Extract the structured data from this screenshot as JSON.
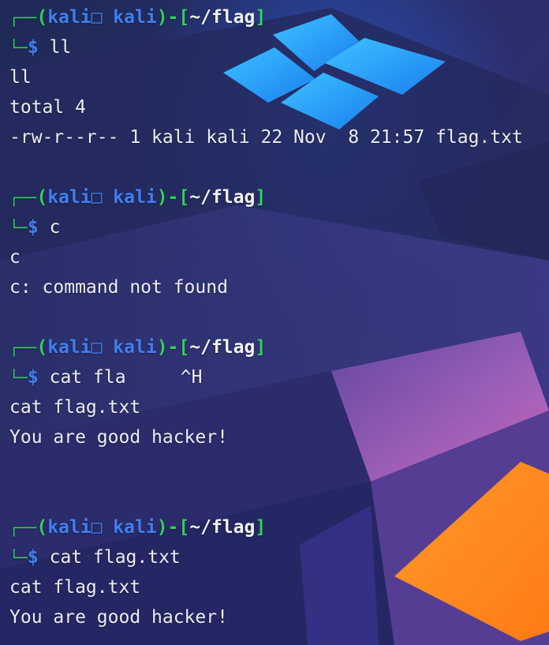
{
  "prompt": {
    "top_corner": "┌──",
    "open_paren": "(",
    "user": "kali",
    "glyph": "□",
    "host": "kali",
    "close_paren": ")",
    "dash": "-",
    "open_bracket": "[",
    "dir": "~/flag",
    "close_bracket": "]",
    "bottom_corner": "└─",
    "dollar": "$"
  },
  "blocks": [
    {
      "command": "ll",
      "output": [
        "ll",
        "total 4",
        "-rw-r--r-- 1 kali kali 22 Nov  8 21:57 flag.txt"
      ]
    },
    {
      "command": "c",
      "output": [
        "c",
        "c: command not found"
      ]
    },
    {
      "command": "cat fla     ^H",
      "output": [
        "cat flag.txt",
        "You are good hacker!"
      ]
    },
    {
      "command": "cat flag.txt",
      "output": [
        "cat flag.txt",
        "You are good hacker!"
      ]
    }
  ],
  "colors": {
    "prompt_green": "#2fd25a",
    "prompt_blue": "#3f7ff0",
    "text": "#ecedf2",
    "accent_orange": "#ff8a1e",
    "logo_blue": "#1e9bff"
  },
  "icons": [
    "windows-logo-icon"
  ]
}
